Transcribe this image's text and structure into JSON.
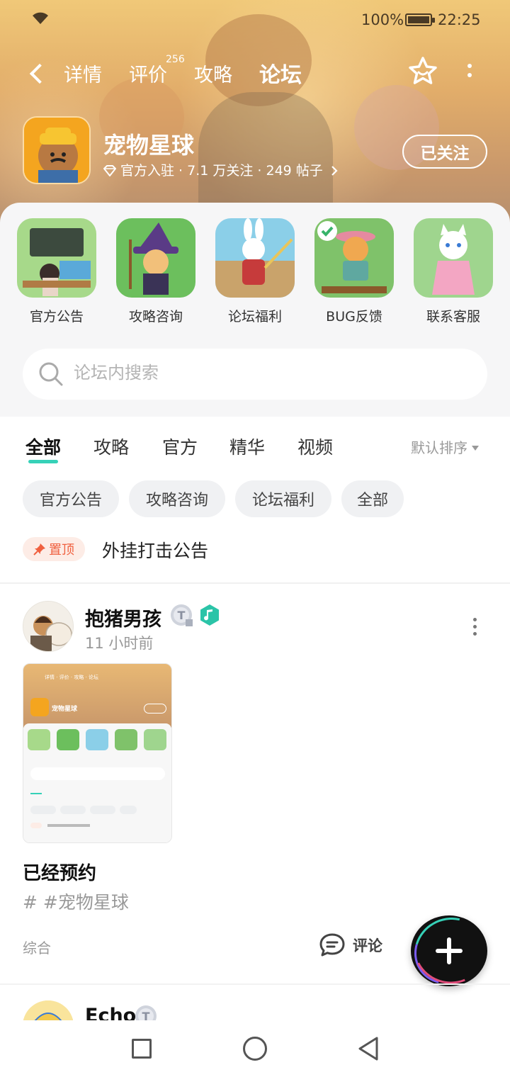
{
  "status_bar": {
    "battery": "100%",
    "time": "22:25"
  },
  "nav": {
    "tabs": [
      {
        "label": "详情"
      },
      {
        "label": "评价",
        "count": "256"
      },
      {
        "label": "攻略"
      },
      {
        "label": "论坛",
        "active": true
      }
    ]
  },
  "game": {
    "name": "宠物星球",
    "meta": "官方入驻 · 7.1 万关注 · 249 帖子",
    "follow_label": "已关注"
  },
  "shortcuts": [
    {
      "label": "官方公告",
      "icon": "announcement-board-icon"
    },
    {
      "label": "攻略咨询",
      "icon": "witch-cat-icon"
    },
    {
      "label": "论坛福利",
      "icon": "rabbit-icon"
    },
    {
      "label": "BUG反馈",
      "icon": "cat-feedback-icon"
    },
    {
      "label": "联系客服",
      "icon": "white-cat-service-icon"
    }
  ],
  "search": {
    "placeholder": "论坛内搜索"
  },
  "filters": {
    "tabs": [
      "全部",
      "攻略",
      "官方",
      "精华",
      "视频"
    ],
    "active": "全部",
    "sort_label": "默认排序"
  },
  "chips": [
    "官方公告",
    "攻略咨询",
    "论坛福利",
    "全部"
  ],
  "pinned": {
    "badge": "置顶",
    "title": "外挂打击公告"
  },
  "post": {
    "author": "抱猪男孩",
    "time": "11 小时前",
    "title": "已经预约",
    "tag": "# #宠物星球",
    "category": "综合",
    "comment_label": "评论"
  },
  "next_post": {
    "author": "Echo"
  },
  "colors": {
    "accent": "#36d1b8",
    "pin_red": "#f0603f",
    "hero_top": "#f0c878",
    "panel_bg": "#f6f6f7"
  }
}
